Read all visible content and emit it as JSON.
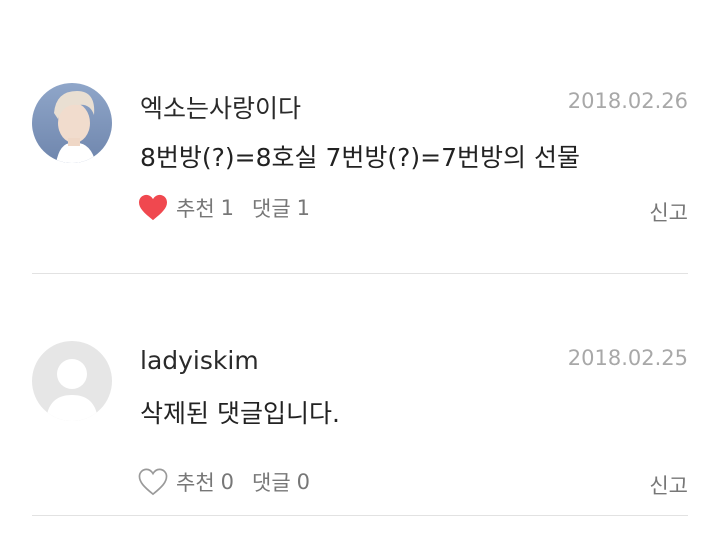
{
  "comments": [
    {
      "author": "엑소는사랑이다",
      "date": "2018.02.26",
      "text": "8번방(?)=8호실 7번방(?)=7번방의 선물",
      "liked": true,
      "like_label": "추천",
      "like_count": "1",
      "reply_label": "댓글",
      "reply_count": "1",
      "report_label": "신고",
      "avatar_icon": "user-photo",
      "heart_icon": "heart-filled-icon",
      "heart_color": "#f0484f"
    },
    {
      "author": "ladyiskim",
      "date": "2018.02.25",
      "text": "삭제된 댓글입니다.",
      "liked": false,
      "like_label": "추천",
      "like_count": "0",
      "reply_label": "댓글",
      "reply_count": "0",
      "report_label": "신고",
      "avatar_icon": "default-avatar-icon",
      "heart_icon": "heart-outline-icon",
      "heart_color": "#9a9a9a"
    }
  ]
}
